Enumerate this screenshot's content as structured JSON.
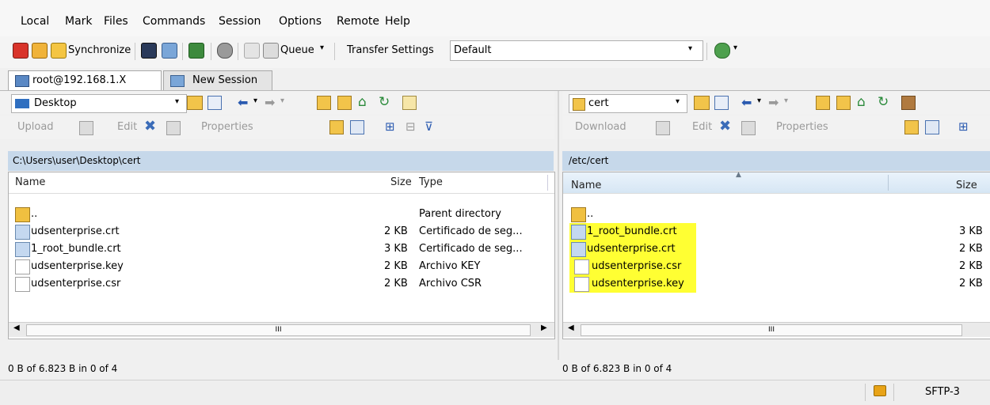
{
  "menu": [
    "Local",
    "Mark",
    "Files",
    "Commands",
    "Session",
    "Options",
    "Remote",
    "Help"
  ],
  "toolbar": {
    "synchronize": "Synchronize",
    "queue": "Queue",
    "transfer_settings_label": "Transfer Settings",
    "transfer_settings_value": "Default"
  },
  "tabs": {
    "session": "root@192.168.1.X",
    "new_session": "New Session"
  },
  "left": {
    "location": "Desktop",
    "actions": [
      "Upload",
      "Edit",
      "Properties"
    ],
    "path": "C:\\Users\\user\\Desktop\\cert",
    "columns": {
      "name": "Name",
      "size": "Size",
      "type": "Type"
    },
    "rows": [
      {
        "name": "..",
        "size": "",
        "type": "Parent directory",
        "icon": "parent-dir-icon"
      },
      {
        "name": "udsenterprise.crt",
        "size": "2 KB",
        "type": "Certificado de seg...",
        "icon": "certificate-file-icon"
      },
      {
        "name": "1_root_bundle.crt",
        "size": "3 KB",
        "type": "Certificado de seg...",
        "icon": "certificate-file-icon"
      },
      {
        "name": "udsenterprise.key",
        "size": "2 KB",
        "type": "Archivo KEY",
        "icon": "blank-file-icon"
      },
      {
        "name": "udsenterprise.csr",
        "size": "2 KB",
        "type": "Archivo CSR",
        "icon": "blank-file-icon"
      }
    ],
    "scroll_thumb_label": "III",
    "status": "0 B of 6.823 B in 0 of 4"
  },
  "right": {
    "location": "cert",
    "actions": [
      "Download",
      "Edit",
      "Properties"
    ],
    "path": "/etc/cert",
    "columns": {
      "name": "Name",
      "size": "Size"
    },
    "rows": [
      {
        "name": "..",
        "size": "",
        "icon": "parent-dir-icon",
        "highlight": false
      },
      {
        "name": "1_root_bundle.crt",
        "size": "3 KB",
        "icon": "certificate-file-icon",
        "highlight": true
      },
      {
        "name": "udsenterprise.crt",
        "size": "2 KB",
        "icon": "certificate-file-icon",
        "highlight": true
      },
      {
        "name": "udsenterprise.csr",
        "size": "2 KB",
        "icon": "blank-file-icon",
        "highlight": true
      },
      {
        "name": "udsenterprise.key",
        "size": "2 KB",
        "icon": "blank-file-icon",
        "highlight": true
      }
    ],
    "scroll_thumb_label": "III",
    "status": "0 B of 6.823 B in 0 of 4"
  },
  "statusbar": {
    "protocol": "SFTP-3"
  },
  "colors": {
    "highlight": "#ffff33",
    "path_bar": "#c6d8ea",
    "lock": "#e8a317"
  }
}
